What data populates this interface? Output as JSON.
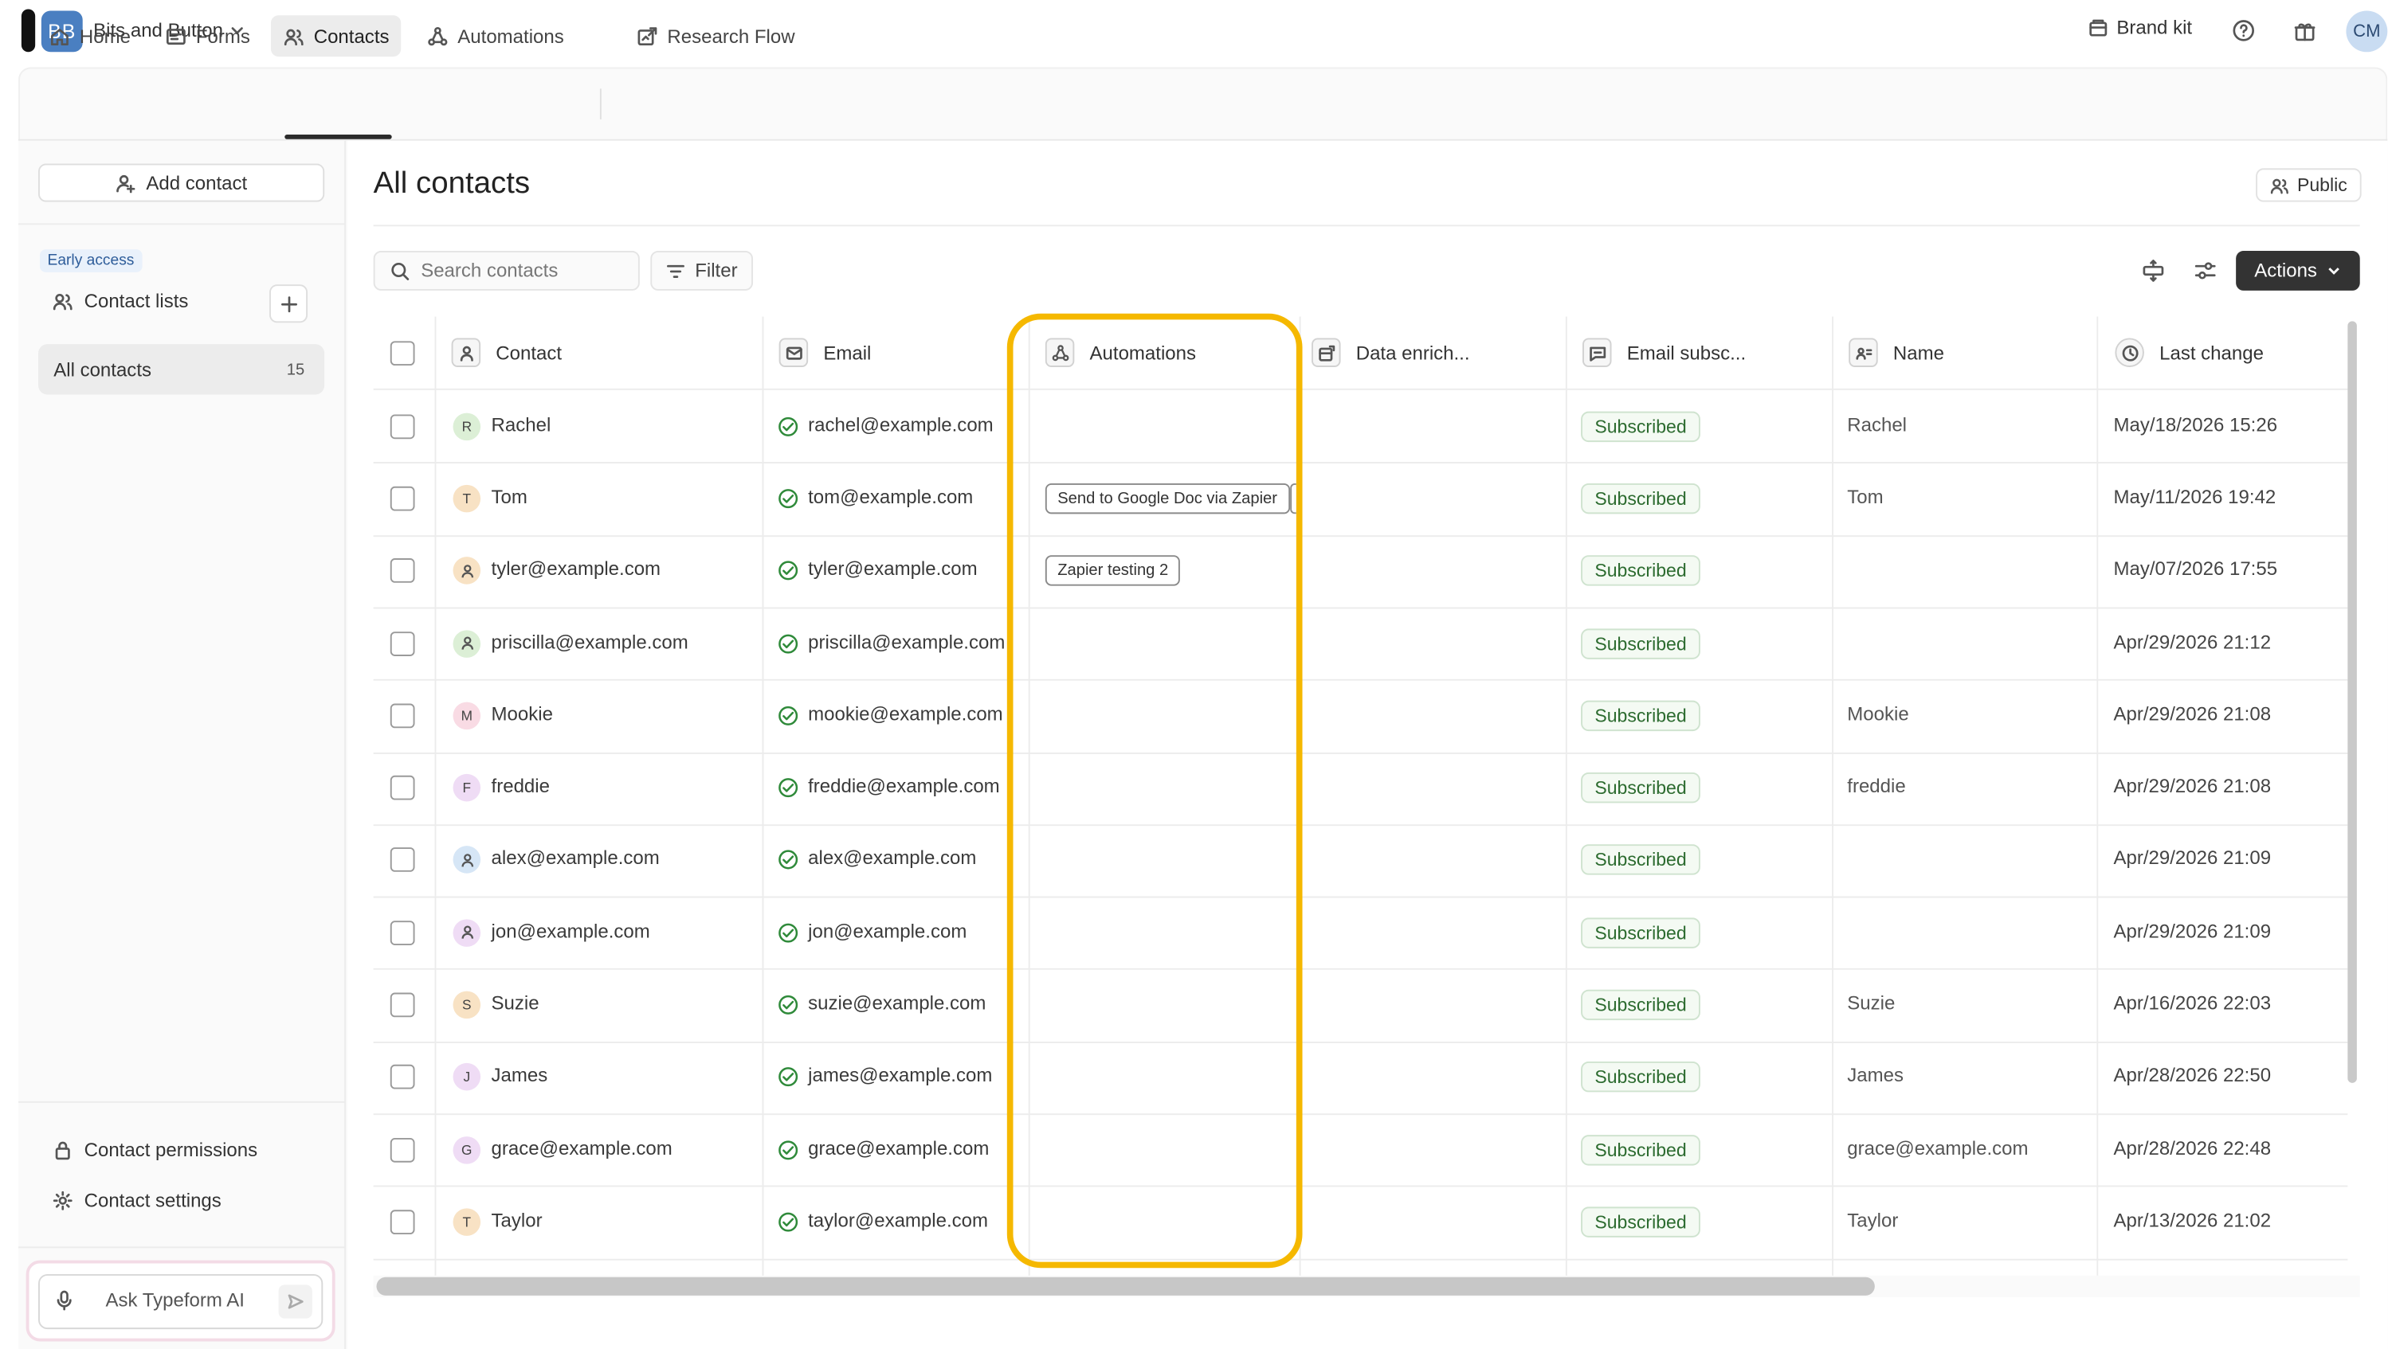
{
  "topbar": {
    "workspace_initials": "BB",
    "workspace_name": "Bits and Button",
    "brand_kit": "Brand kit",
    "user_initials": "CM"
  },
  "nav": {
    "tabs": [
      {
        "label": "Home",
        "icon": "home-icon"
      },
      {
        "label": "Forms",
        "icon": "forms-icon"
      },
      {
        "label": "Contacts",
        "icon": "users-icon",
        "active": true
      },
      {
        "label": "Automations",
        "icon": "automations-icon"
      },
      {
        "label": "Research Flow",
        "icon": "research-flow-icon"
      }
    ]
  },
  "sidebar": {
    "add_contact": "Add contact",
    "early_access": "Early access",
    "contact_lists": "Contact lists",
    "all_contacts": "All contacts",
    "all_contacts_count": "15",
    "contact_permissions": "Contact permissions",
    "contact_settings": "Contact settings",
    "ai_placeholder": "Ask Typeform AI"
  },
  "main": {
    "title": "All contacts",
    "visibility": "Public",
    "search_placeholder": "Search contacts",
    "filter": "Filter",
    "actions": "Actions"
  },
  "table": {
    "columns": [
      "Contact",
      "Email",
      "Automations",
      "Data enrich...",
      "Email subsc...",
      "Name",
      "Last change"
    ],
    "rows": [
      {
        "initial": "R",
        "avatar_color": "#dcefd6",
        "contact": "Rachel",
        "email": "rachel@example.com",
        "automation": "",
        "subscription": "Subscribed",
        "name": "Rachel",
        "last_change": "May/18/2026 15:26"
      },
      {
        "initial": "T",
        "avatar_color": "#f8e2c4",
        "contact": "Tom",
        "email": "tom@example.com",
        "automation": "Send to Google Doc via Zapier",
        "subscription": "Subscribed",
        "name": "Tom",
        "last_change": "May/11/2026 19:42"
      },
      {
        "initial": "",
        "avatar_color": "#f8e2c4",
        "contact": "tyler@example.com",
        "email": "tyler@example.com",
        "automation": "Zapier testing 2",
        "subscription": "Subscribed",
        "name": "",
        "last_change": "May/07/2026 17:55"
      },
      {
        "initial": "",
        "avatar_color": "#dcefd6",
        "contact": "priscilla@example.com",
        "email": "priscilla@example.com",
        "automation": "",
        "subscription": "Subscribed",
        "name": "",
        "last_change": "Apr/29/2026 21:12"
      },
      {
        "initial": "M",
        "avatar_color": "#f9dbe4",
        "contact": "Mookie",
        "email": "mookie@example.com",
        "automation": "",
        "subscription": "Subscribed",
        "name": "Mookie",
        "last_change": "Apr/29/2026 21:08"
      },
      {
        "initial": "F",
        "avatar_color": "#efdcf5",
        "contact": "freddie",
        "email": "freddie@example.com",
        "automation": "",
        "subscription": "Subscribed",
        "name": "freddie",
        "last_change": "Apr/29/2026 21:08"
      },
      {
        "initial": "",
        "avatar_color": "#d6e6f6",
        "contact": "alex@example.com",
        "email": "alex@example.com",
        "automation": "",
        "subscription": "Subscribed",
        "name": "",
        "last_change": "Apr/29/2026 21:09"
      },
      {
        "initial": "",
        "avatar_color": "#efdcf5",
        "contact": "jon@example.com",
        "email": "jon@example.com",
        "automation": "",
        "subscription": "Subscribed",
        "name": "",
        "last_change": "Apr/29/2026 21:09"
      },
      {
        "initial": "S",
        "avatar_color": "#f8e2c4",
        "contact": "Suzie",
        "email": "suzie@example.com",
        "automation": "",
        "subscription": "Subscribed",
        "name": "Suzie",
        "last_change": "Apr/16/2026 22:03"
      },
      {
        "initial": "J",
        "avatar_color": "#efdcf5",
        "contact": "James",
        "email": "james@example.com",
        "automation": "",
        "subscription": "Subscribed",
        "name": "James",
        "last_change": "Apr/28/2026 22:50"
      },
      {
        "initial": "G",
        "avatar_color": "#efdcf5",
        "contact": "grace@example.com",
        "email": "grace@example.com",
        "automation": "",
        "subscription": "Subscribed",
        "name": "grace@example.com",
        "last_change": "Apr/28/2026 22:48"
      },
      {
        "initial": "T",
        "avatar_color": "#f8e2c4",
        "contact": "Taylor",
        "email": "taylor@example.com",
        "automation": "",
        "subscription": "Subscribed",
        "name": "Taylor",
        "last_change": "Apr/13/2026 21:02"
      }
    ]
  },
  "colors": {
    "highlight": "#f5b800",
    "subscribed_text": "#2c6b2f",
    "verified_check": "#2f8a3a",
    "actions_bg": "#333333"
  }
}
